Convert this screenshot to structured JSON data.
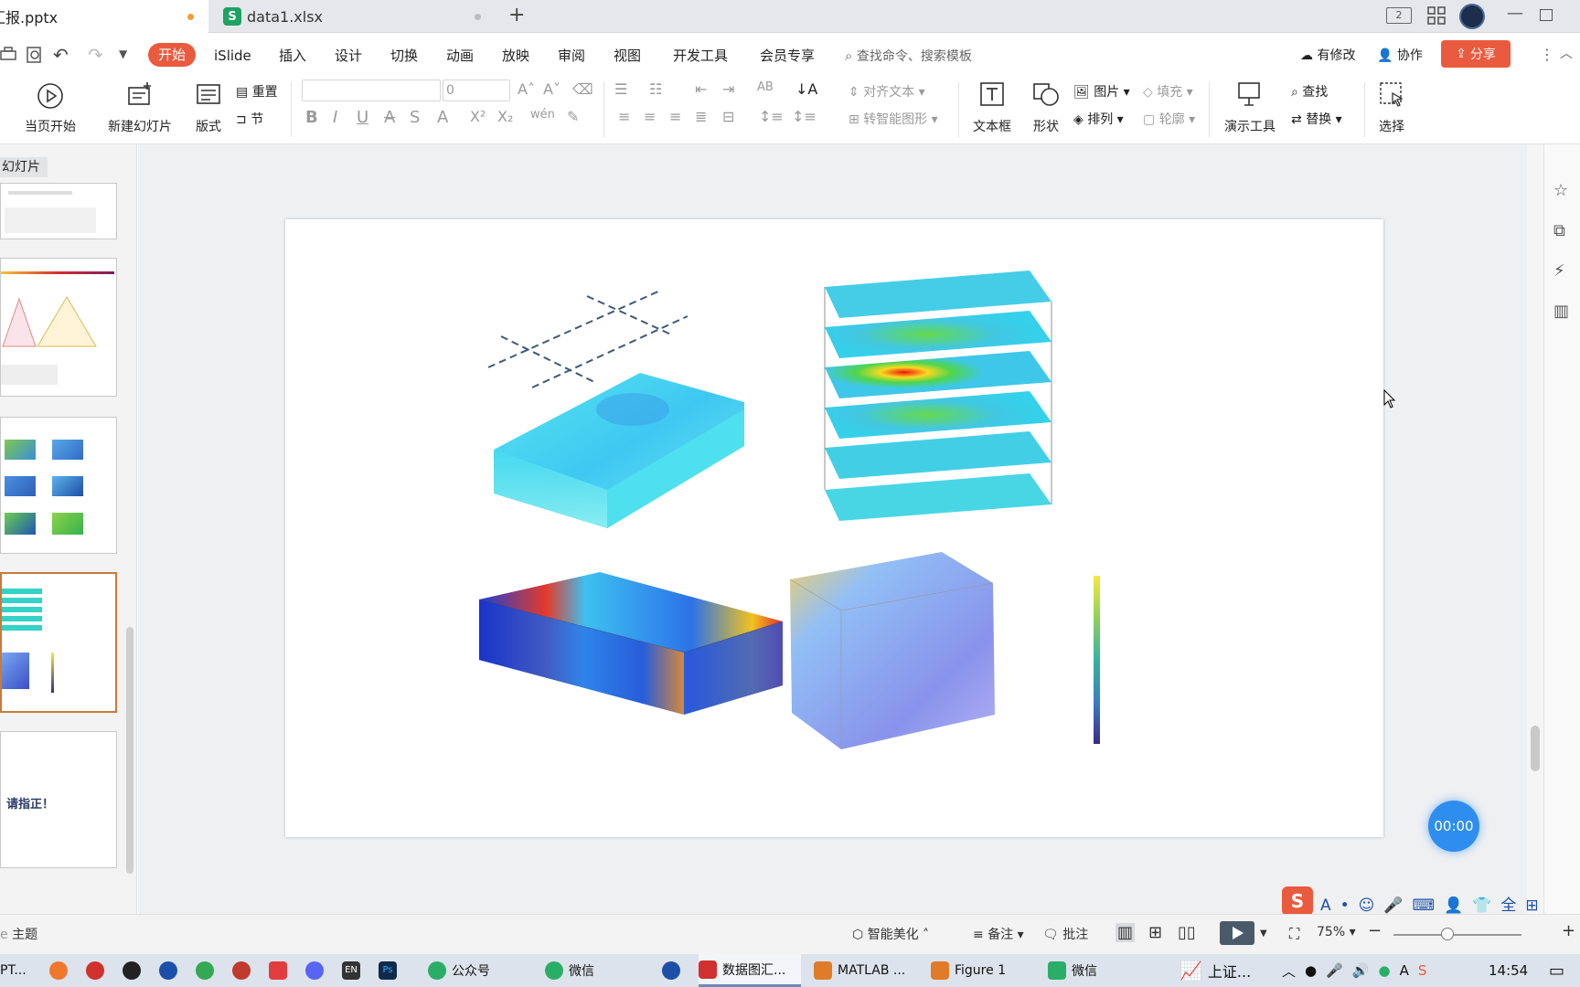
{
  "tabs": [
    {
      "label": "汇报.pptx",
      "active": true,
      "modified_color": "#f0a030"
    },
    {
      "label": "data1.xlsx",
      "active": false
    }
  ],
  "window_controls": [
    "2",
    "grid",
    "user",
    "minimize",
    "restore"
  ],
  "menu": {
    "items": [
      "开始",
      "iSlide",
      "插入",
      "设计",
      "切换",
      "动画",
      "放映",
      "审阅",
      "视图",
      "开发工具",
      "会员专享"
    ],
    "active": "开始",
    "search_placeholder": "查找命令、搜索模板",
    "right": {
      "modify": "有修改",
      "collab": "协作",
      "share": "分享"
    },
    "accent": "#ea5a3e"
  },
  "ribbon": {
    "play_from_current": "当页开始",
    "new_slide": "新建幻灯片",
    "layout": "版式",
    "reset": "重置",
    "section": "节",
    "font_size": "0",
    "align_text": "对齐文本",
    "smart_shape": "转智能图形",
    "textbox": "文本框",
    "shape": "形状",
    "picture": "图片",
    "fill": "填充",
    "arrange": "排列",
    "outline": "轮廓",
    "present_tools": "演示工具",
    "find": "查找",
    "replace": "替换",
    "select": "选择"
  },
  "left_panel": {
    "tag": "幻灯片",
    "last_slide_text": "请指正！",
    "selected_color": "#c87a3c"
  },
  "slide": {
    "colorbar_colors": [
      "#f6e93c",
      "#8fd25a",
      "#35b3a0",
      "#3a7fc2",
      "#3b2a8a"
    ]
  },
  "timer": "00:00",
  "status": {
    "theme": "主题",
    "beautify": "智能美化",
    "notes": "备注",
    "comment": "批注",
    "zoom": "75%"
  },
  "taskbar": {
    "items": [
      {
        "label": "PT...",
        "color": "#c0392b"
      },
      {
        "label": "公众号",
        "color": "#2aae67"
      },
      {
        "label": "微信",
        "color": "#2aae67"
      },
      {
        "label": "数据图汇...",
        "color": "#d0312d",
        "active": true
      },
      {
        "label": "MATLAB ...",
        "color": "#e07b2a"
      },
      {
        "label": "Figure 1",
        "color": "#e07b2a"
      },
      {
        "label": "微信",
        "color": "#2aae67"
      }
    ],
    "stock": "上证...",
    "time": "14:54"
  }
}
